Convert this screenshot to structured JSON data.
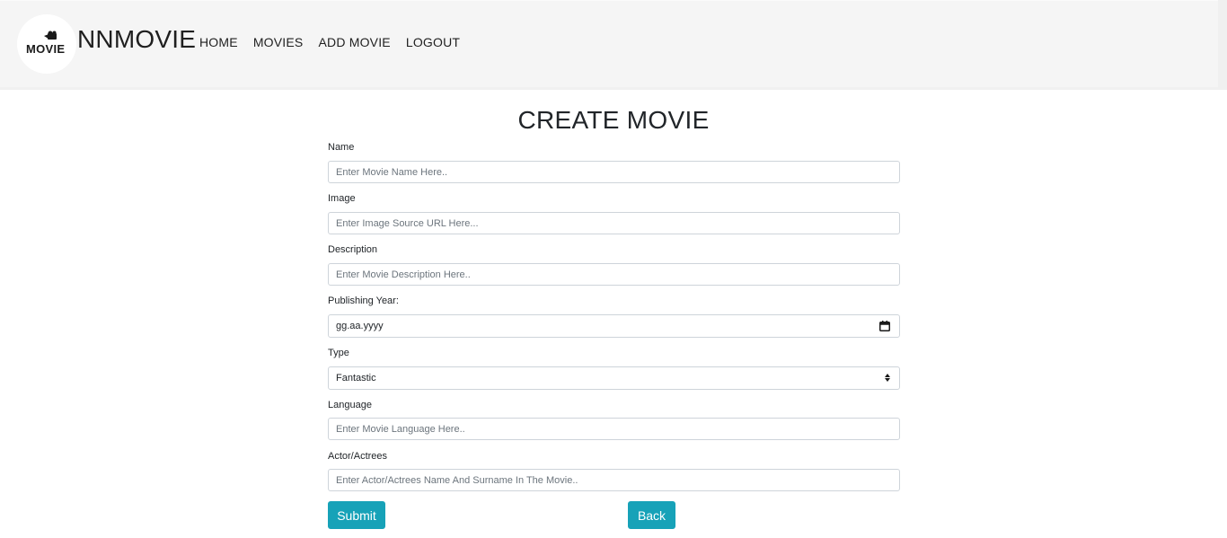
{
  "brand": {
    "logo_text": "MOVIE",
    "name": "NNMOVIE"
  },
  "nav": {
    "items": [
      {
        "label": "HOME"
      },
      {
        "label": "MOVIES"
      },
      {
        "label": "ADD MOVIE"
      },
      {
        "label": "LOGOUT"
      }
    ]
  },
  "page": {
    "title": "CREATE MOVIE"
  },
  "form": {
    "name": {
      "label": "Name",
      "placeholder": "Enter Movie Name Here.."
    },
    "image": {
      "label": "Image",
      "placeholder": "Enter Image Source URL Here..."
    },
    "description": {
      "label": "Description",
      "placeholder": "Enter Movie Description Here.."
    },
    "year": {
      "label": "Publishing Year:",
      "value": "gg.aa.yyyy"
    },
    "type": {
      "label": "Type",
      "selected": "Fantastic"
    },
    "language": {
      "label": "Language",
      "placeholder": "Enter Movie Language Here.."
    },
    "actor": {
      "label": "Actor/Actrees",
      "placeholder": "Enter Actor/Actrees Name And Surname In The Movie.."
    },
    "submit_label": "Submit",
    "back_label": "Back"
  },
  "colors": {
    "accent": "#17a2b8",
    "navbar_bg": "#f5f5f5",
    "input_border": "#ced4da"
  },
  "icons": {
    "date_field": "calendar-icon",
    "select_field": "select-arrows-icon",
    "logo": "camera-icon"
  }
}
